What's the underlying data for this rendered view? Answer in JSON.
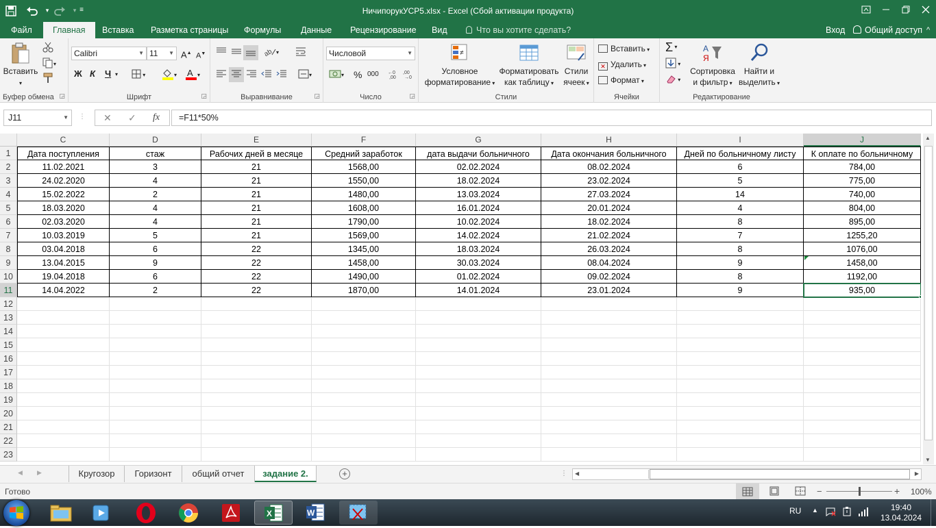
{
  "window": {
    "title": "НичипорукУСР5.xlsx - Excel (Сбой активации продукта)",
    "restore_icon": "restore-icon",
    "minimize_icon": "minimize-icon",
    "maximize_icon": "maximize-icon",
    "close_icon": "close-icon"
  },
  "quick_access": [
    "save-icon",
    "undo-icon",
    "redo-icon",
    "customize-icon"
  ],
  "tabs": [
    {
      "label": "Файл"
    },
    {
      "label": "Главная",
      "active": true
    },
    {
      "label": "Вставка"
    },
    {
      "label": "Разметка страницы"
    },
    {
      "label": "Формулы"
    },
    {
      "label": "Данные"
    },
    {
      "label": "Рецензирование"
    },
    {
      "label": "Вид"
    }
  ],
  "tell_me": "Что вы хотите сделать?",
  "signin": "Вход",
  "share": "Общий доступ",
  "ribbon": {
    "clipboard": {
      "paste": "Вставить",
      "group": "Буфер обмена"
    },
    "font": {
      "name": "Calibri",
      "size": "11",
      "bold": "Ж",
      "italic": "К",
      "underline": "Ч",
      "group": "Шрифт",
      "fill_color": "#ffff00",
      "font_color": "#ff0000"
    },
    "alignment": {
      "group": "Выравнивание"
    },
    "number": {
      "format": "Числовой",
      "percent": "%",
      "thousands": "000",
      "group": "Число"
    },
    "styles": {
      "cond_format_1": "Условное",
      "cond_format_2": "форматирование",
      "format_table_1": "Форматировать",
      "format_table_2": "как таблицу",
      "cell_styles_1": "Стили",
      "cell_styles_2": "ячеек",
      "group": "Стили"
    },
    "cells": {
      "insert": "Вставить",
      "delete": "Удалить",
      "format": "Формат",
      "group": "Ячейки"
    },
    "editing": {
      "sort_1": "Сортировка",
      "sort_2": "и фильтр",
      "find_1": "Найти и",
      "find_2": "выделить",
      "group": "Редактирование"
    }
  },
  "formula_bar": {
    "name_box": "J11",
    "cancel": "✕",
    "enter": "✓",
    "fx": "fx",
    "formula": "=F11*50%"
  },
  "columns": [
    "C",
    "D",
    "E",
    "F",
    "G",
    "H",
    "I",
    "J"
  ],
  "selected_column": "J",
  "selected_row": 11,
  "row_numbers": [
    1,
    2,
    3,
    4,
    5,
    6,
    7,
    8,
    9,
    10,
    11,
    12,
    13,
    14,
    15,
    16,
    17,
    18,
    19,
    20,
    21,
    22,
    23
  ],
  "headers": [
    "Дата поступления",
    "стаж",
    "Рабочих дней в месяце",
    "Средний заработок",
    "дата выдачи больничного",
    "Дата окончания больничного",
    "Дней по больничному листу",
    "К оплате по больничному"
  ],
  "rows": [
    [
      "11.02.2021",
      "3",
      "21",
      "1568,00",
      "02.02.2024",
      "08.02.2024",
      "6",
      "784,00"
    ],
    [
      "24.02.2020",
      "4",
      "21",
      "1550,00",
      "18.02.2024",
      "23.02.2024",
      "5",
      "775,00"
    ],
    [
      "15.02.2022",
      "2",
      "21",
      "1480,00",
      "13.03.2024",
      "27.03.2024",
      "14",
      "740,00"
    ],
    [
      "18.03.2020",
      "4",
      "21",
      "1608,00",
      "16.01.2024",
      "20.01.2024",
      "4",
      "804,00"
    ],
    [
      "02.03.2020",
      "4",
      "21",
      "1790,00",
      "10.02.2024",
      "18.02.2024",
      "8",
      "895,00"
    ],
    [
      "10.03.2019",
      "5",
      "21",
      "1569,00",
      "14.02.2024",
      "21.02.2024",
      "7",
      "1255,20"
    ],
    [
      "03.04.2018",
      "6",
      "22",
      "1345,00",
      "18.03.2024",
      "26.03.2024",
      "8",
      "1076,00"
    ],
    [
      "13.04.2015",
      "9",
      "22",
      "1458,00",
      "30.03.2024",
      "08.04.2024",
      "9",
      "1458,00"
    ],
    [
      "19.04.2018",
      "6",
      "22",
      "1490,00",
      "01.02.2024",
      "09.02.2024",
      "8",
      "1192,00"
    ],
    [
      "14.04.2022",
      "2",
      "22",
      "1870,00",
      "14.01.2024",
      "23.01.2024",
      "9",
      "935,00"
    ]
  ],
  "sheets": [
    {
      "label": "Кругозор"
    },
    {
      "label": "Горизонт"
    },
    {
      "label": "общий отчет"
    },
    {
      "label": "задание 2.",
      "active": true
    }
  ],
  "status": {
    "ready": "Готово",
    "zoom": "100%",
    "zoom_fraction": 0.5
  },
  "taskbar": {
    "lang": "RU",
    "time": "19:40",
    "date": "13.04.2024",
    "apps": [
      "windows-start-icon",
      "file-explorer-icon",
      "media-player-icon",
      "opera-icon",
      "chrome-icon",
      "acrobat-icon",
      "excel-icon",
      "word-icon",
      "snipping-tool-icon"
    ]
  },
  "colors": {
    "accent": "#217346",
    "selection": "#217346"
  }
}
